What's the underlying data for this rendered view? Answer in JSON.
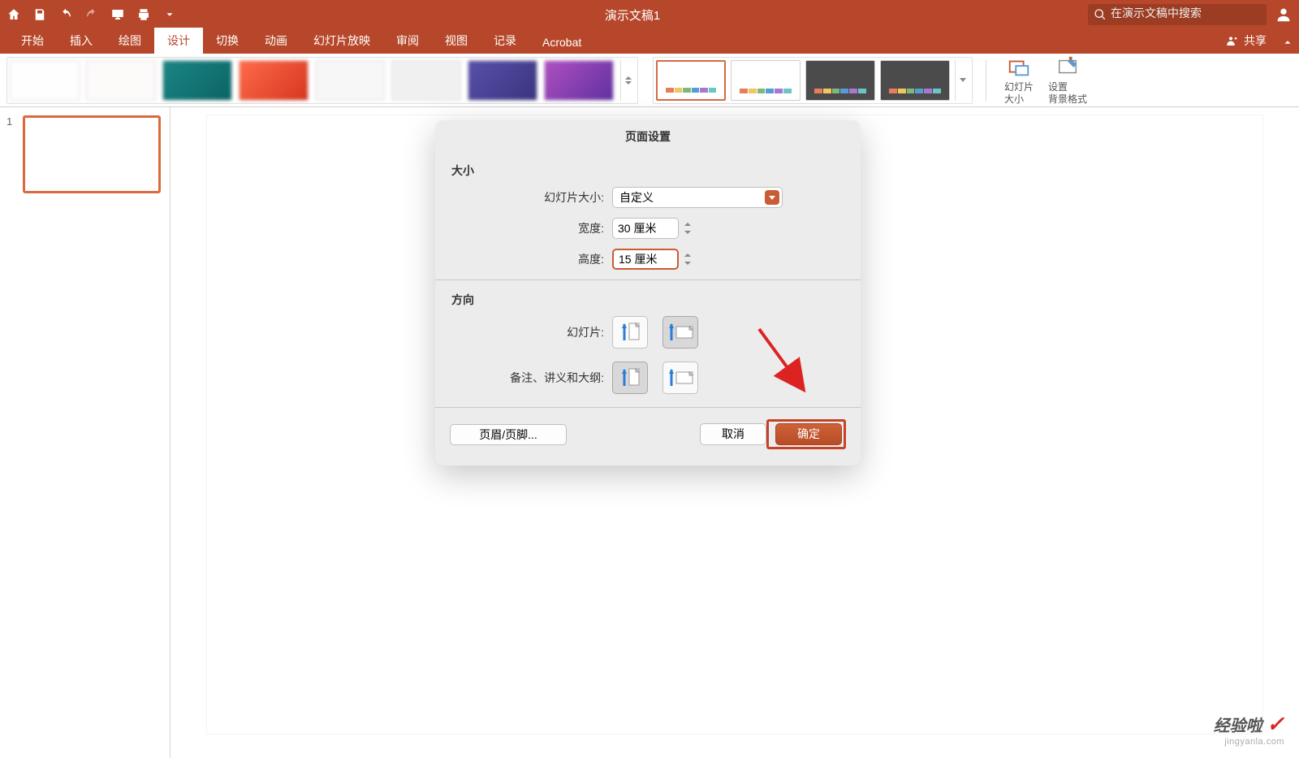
{
  "titlebar": {
    "title": "演示文稿1",
    "search_placeholder": "在演示文稿中搜索"
  },
  "tabs": {
    "items": [
      "开始",
      "插入",
      "绘图",
      "设计",
      "切换",
      "动画",
      "幻灯片放映",
      "审阅",
      "视图",
      "记录",
      "Acrobat"
    ],
    "active_index": 3,
    "share": "共享"
  },
  "ribbon": {
    "slide_size_label1": "幻灯片",
    "slide_size_label2": "大小",
    "bg_format_label1": "设置",
    "bg_format_label2": "背景格式"
  },
  "thumbs": {
    "items": [
      {
        "num": "1"
      }
    ]
  },
  "dialog": {
    "title": "页面设置",
    "section_size": "大小",
    "slide_size_label": "幻灯片大小:",
    "slide_size_value": "自定义",
    "width_label": "宽度:",
    "width_value": "30 厘米",
    "height_label": "高度:",
    "height_value": "15 厘米",
    "section_orient": "方向",
    "orient_slides_label": "幻灯片:",
    "orient_notes_label": "备注、讲义和大纲:",
    "header_footer_btn": "页眉/页脚...",
    "cancel": "取消",
    "ok": "确定"
  },
  "watermark": {
    "line1": "经验啦",
    "line2": "jingyanla.com"
  }
}
